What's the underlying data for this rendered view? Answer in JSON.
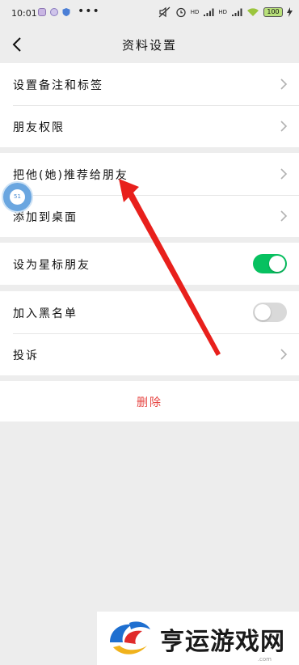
{
  "status_bar": {
    "time": "10:01",
    "more": "•••",
    "battery": "100",
    "hd_label": "HD"
  },
  "nav": {
    "title": "资料设置"
  },
  "groups": [
    {
      "items": [
        {
          "label": "设置备注和标签",
          "type": "chevron"
        },
        {
          "label": "朋友权限",
          "type": "chevron"
        }
      ]
    },
    {
      "items": [
        {
          "label": "把他(她)推荐给朋友",
          "type": "chevron"
        },
        {
          "label": "添加到桌面",
          "type": "chevron"
        }
      ]
    },
    {
      "items": [
        {
          "label": "设为星标朋友",
          "type": "toggle",
          "on": true
        }
      ]
    },
    {
      "items": [
        {
          "label": "加入黑名单",
          "type": "toggle",
          "on": false
        },
        {
          "label": "投诉",
          "type": "chevron"
        }
      ]
    }
  ],
  "delete": {
    "label": "删除",
    "color": "#e64340"
  },
  "colors": {
    "toggle_on": "#07c160",
    "annotation_arrow": "#e8201c"
  },
  "floating_ball": {
    "text": "51"
  },
  "watermark": {
    "text": "亨运游戏网",
    "small": ".com"
  }
}
